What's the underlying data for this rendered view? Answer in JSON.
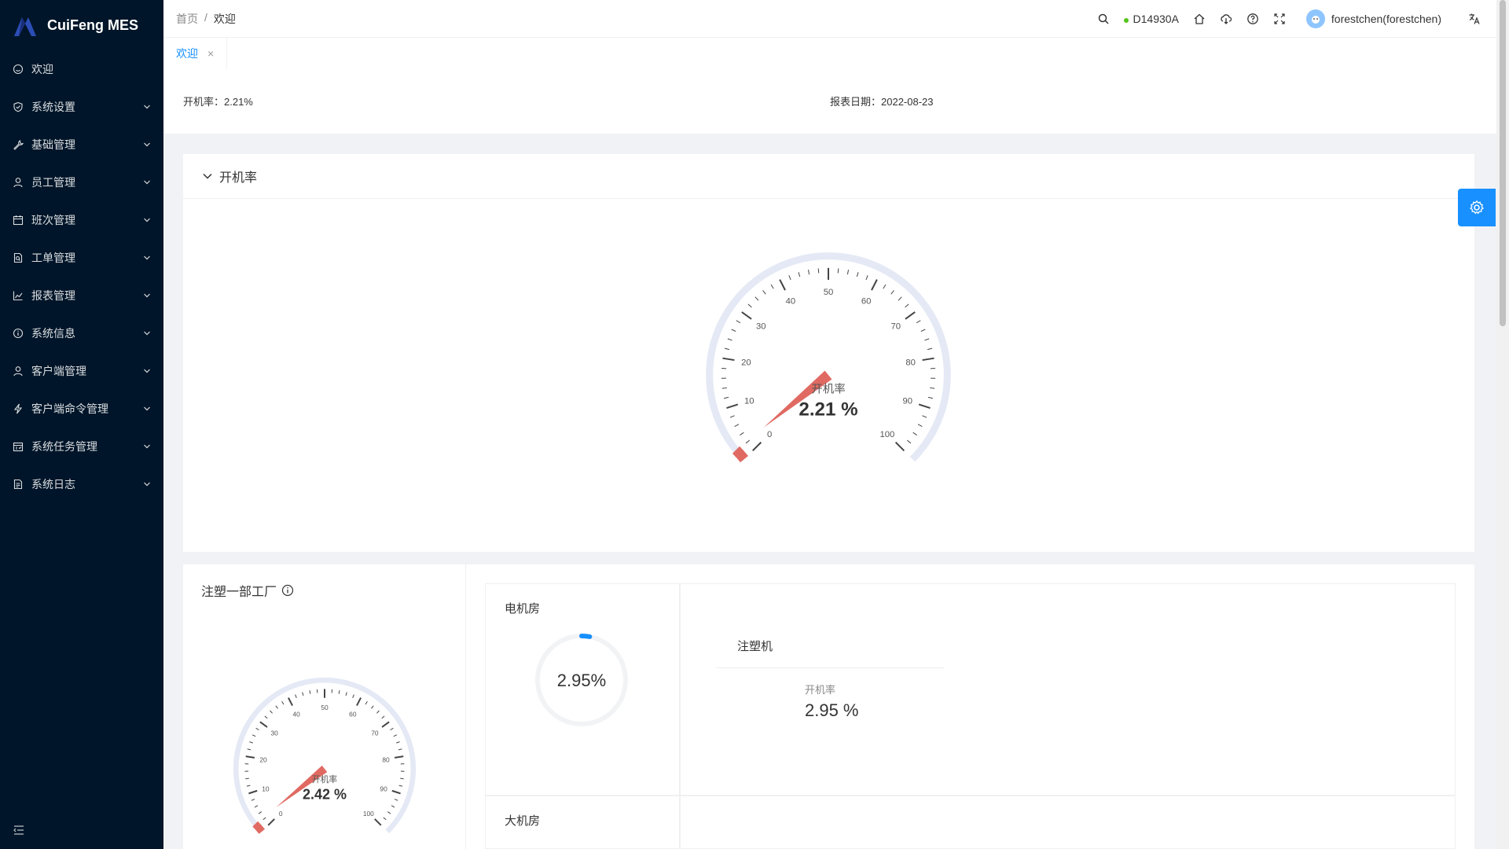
{
  "app": {
    "name": "CuiFeng MES"
  },
  "sidebar": {
    "items": [
      {
        "label": "欢迎",
        "icon": "smile-icon",
        "expandable": false
      },
      {
        "label": "系统设置",
        "icon": "shield-icon",
        "expandable": true
      },
      {
        "label": "基础管理",
        "icon": "tool-icon",
        "expandable": true
      },
      {
        "label": "员工管理",
        "icon": "user-icon",
        "expandable": true
      },
      {
        "label": "班次管理",
        "icon": "calendar-icon",
        "expandable": true
      },
      {
        "label": "工单管理",
        "icon": "file-search-icon",
        "expandable": true
      },
      {
        "label": "报表管理",
        "icon": "line-chart-icon",
        "expandable": true
      },
      {
        "label": "系统信息",
        "icon": "info-icon",
        "expandable": true
      },
      {
        "label": "客户端管理",
        "icon": "user-icon",
        "expandable": true
      },
      {
        "label": "客户端命令管理",
        "icon": "thunderbolt-icon",
        "expandable": true
      },
      {
        "label": "系统任务管理",
        "icon": "schedule-icon",
        "expandable": true
      },
      {
        "label": "系统日志",
        "icon": "file-text-icon",
        "expandable": true
      }
    ]
  },
  "header": {
    "breadcrumb": [
      "首页",
      "欢迎"
    ],
    "separator": "/",
    "device_id": "D14930A",
    "user": "forestchen(forestchen)"
  },
  "tabs": [
    {
      "label": "欢迎",
      "close": "×"
    }
  ],
  "summary": {
    "rate_text": "开机率：2.21%",
    "date_text": "报表日期：2022-08-23"
  },
  "overall": {
    "title": "开机率",
    "gauge_label": "开机率",
    "value": 2.21,
    "value_text": "2.21 %"
  },
  "factory": {
    "title": "注塑一部工厂",
    "gauge_label": "开机率",
    "value": 2.42,
    "value_text": "2.42 %"
  },
  "rooms": [
    {
      "title": "电机房",
      "value": 2.95,
      "value_text": "2.95%",
      "machine_title": "注塑机",
      "metric_label": "开机率",
      "metric_value": "2.95 %"
    },
    {
      "title": "大机房"
    }
  ],
  "gauge_ticks": [
    "0",
    "10",
    "20",
    "30",
    "40",
    "50",
    "60",
    "70",
    "80",
    "90",
    "100"
  ],
  "colors": {
    "sidebar_bg": "#001529",
    "accent": "#1890ff",
    "gauge_pointer": "#e06a62",
    "gauge_track": "#e4e9f5",
    "status_online": "#52c41a"
  }
}
